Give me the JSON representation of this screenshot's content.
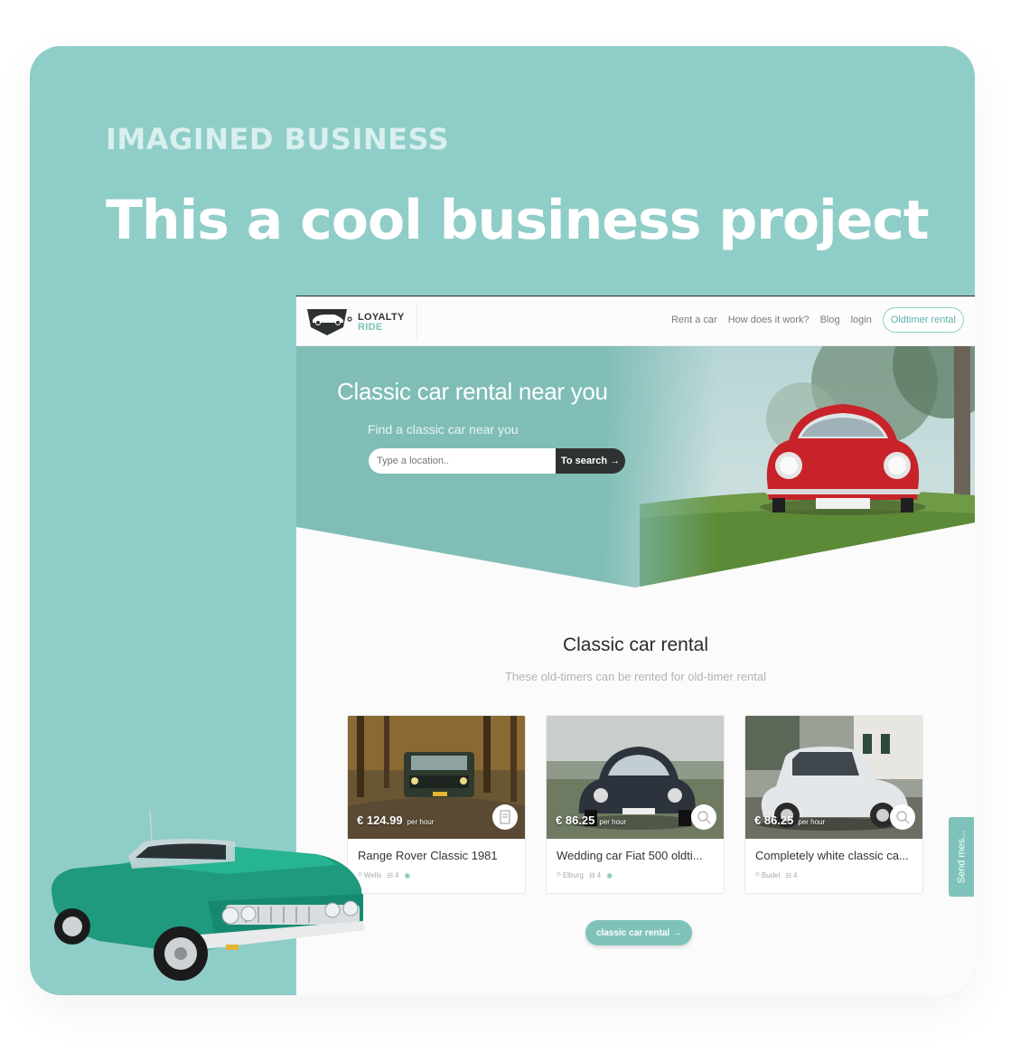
{
  "eyebrow": "IMAGINED BUSINESS",
  "headline": "This a cool business project",
  "site": {
    "logo": {
      "line1": "LOYALTY",
      "line2": "RIDE"
    },
    "nav": {
      "links": [
        "Rent a car",
        "How does it work?",
        "Blog",
        "login"
      ],
      "cta": "Oldtimer rental"
    },
    "hero": {
      "title": "Classic car rental near you",
      "subtitle": "Find a classic car near you",
      "search_placeholder": "Type a location..",
      "search_button": "To search"
    },
    "section": {
      "title": "Classic car rental",
      "subtitle": "These old-timers can be rented for old-timer rental"
    },
    "cars": [
      {
        "price": "€ 124.99",
        "unit": "per hour",
        "name": "Range Rover Classic 1981",
        "location": "Wells",
        "seats": "4"
      },
      {
        "price": "€ 86.25",
        "unit": "per hour",
        "name": "Wedding car Fiat 500 oldti...",
        "location": "Elburg",
        "seats": "4"
      },
      {
        "price": "€ 86.25",
        "unit": "per hour",
        "name": "Completely white classic ca...",
        "location": "Budel",
        "seats": "4"
      }
    ],
    "more_button": "classic car rental"
  },
  "side_tab": "Send mes...",
  "colors": {
    "teal": "#8fcdc8",
    "teal_dark": "#7fc2bb",
    "dark": "#2f3232"
  }
}
